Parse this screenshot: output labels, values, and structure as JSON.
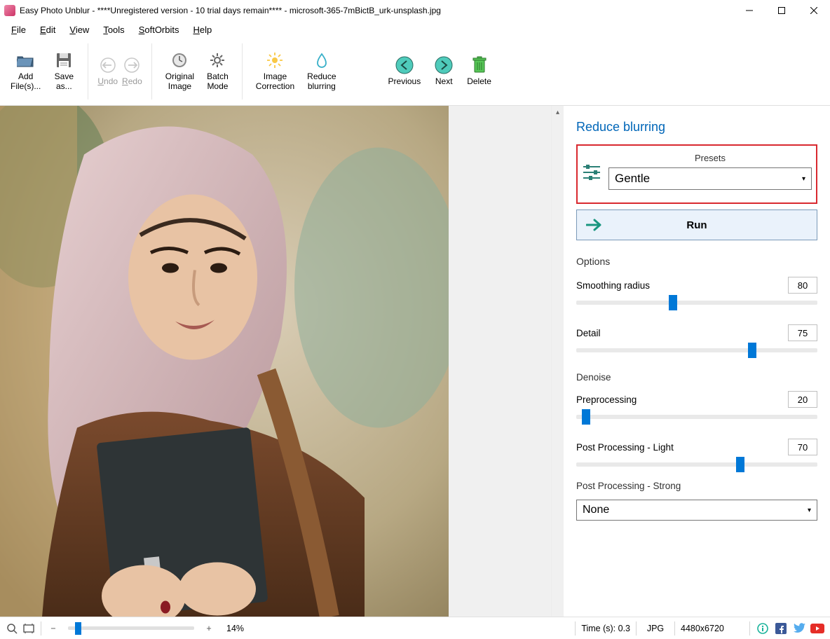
{
  "window": {
    "title": "Easy Photo Unblur - ****Unregistered version - 10 trial days remain**** - microsoft-365-7mBictB_urk-unsplash.jpg"
  },
  "menu": {
    "file": "File",
    "edit": "Edit",
    "view": "View",
    "tools": "Tools",
    "softorbits": "SoftOrbits",
    "help": "Help"
  },
  "toolbar": {
    "add_files": "Add\nFile(s)...",
    "save_as": "Save\nas...",
    "undo": "Undo",
    "redo": "Redo",
    "original_image": "Original\nImage",
    "batch_mode": "Batch\nMode",
    "image_correction": "Image\nCorrection",
    "reduce_blurring": "Reduce\nblurring",
    "previous": "Previous",
    "next": "Next",
    "delete": "Delete"
  },
  "panel": {
    "title": "Reduce blurring",
    "presets_label": "Presets",
    "preset_value": "Gentle",
    "run_label": "Run",
    "options_label": "Options",
    "smoothing_radius_label": "Smoothing radius",
    "smoothing_radius_value": "80",
    "smoothing_radius_pct": 40,
    "detail_label": "Detail",
    "detail_value": "75",
    "detail_pct": 73,
    "denoise_label": "Denoise",
    "preprocessing_label": "Preprocessing",
    "preprocessing_value": "20",
    "preprocessing_pct": 4,
    "postproc_light_label": "Post Processing - Light",
    "postproc_light_value": "70",
    "postproc_light_pct": 68,
    "postproc_strong_label": "Post Processing - Strong",
    "postproc_strong_value": "None"
  },
  "status": {
    "zoom_pct": "14%",
    "time": "Time (s): 0.3",
    "format": "JPG",
    "dimensions": "4480x6720"
  },
  "colors": {
    "accent": "#0078d7",
    "panel_title": "#0066b8",
    "highlight_border": "#d9292f"
  }
}
